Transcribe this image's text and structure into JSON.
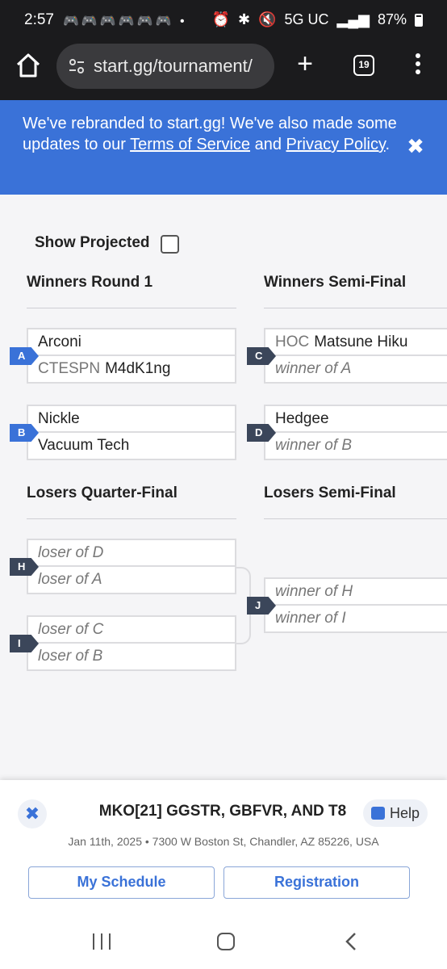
{
  "status_bar": {
    "time": "2:57",
    "notification_icons": "🎮🎮🎮🎮🎮🎮 •",
    "network": "5G UC",
    "battery": "87%"
  },
  "browser": {
    "url": "start.gg/tournament/",
    "tab_count": "19"
  },
  "banner": {
    "text_before": "We've rebranded to start.gg! We've also made some updates to our ",
    "terms_link": "Terms of Service",
    "text_middle": " and ",
    "privacy_link": "Privacy Policy",
    "text_after": "."
  },
  "bracket": {
    "show_projected_label": "Show Projected",
    "rounds": {
      "winners_r1": "Winners Round 1",
      "winners_semi": "Winners Semi-Final",
      "losers_quarter": "Losers Quarter-Final",
      "losers_semi": "Losers Semi-Final"
    },
    "matches": {
      "A": {
        "id": "A",
        "p1": "Arconi",
        "p2_prefix": "CTESPN",
        "p2": "M4dK1ng"
      },
      "B": {
        "id": "B",
        "p1": "Nickle",
        "p2": "Vacuum Tech"
      },
      "C": {
        "id": "C",
        "p1_prefix": "HOC",
        "p1": "Matsune Hiku",
        "p2": "winner of A"
      },
      "D": {
        "id": "D",
        "p1": "Hedgee",
        "p2": "winner of B"
      },
      "H": {
        "id": "H",
        "p1": "loser of D",
        "p2": "loser of A"
      },
      "I": {
        "id": "I",
        "p1": "loser of C",
        "p2": "loser of B"
      },
      "J": {
        "id": "J",
        "p1": "winner of H",
        "p2": "winner of I"
      }
    }
  },
  "sheet": {
    "close_icon": "✖",
    "title": "MKO[21] GGSTR, GBFVR, AND T8",
    "help_label": "Help",
    "details": "Jan 11th, 2025 • 7300 W Boston St, Chandler, AZ 85226, USA",
    "my_schedule": "My Schedule",
    "registration": "Registration"
  },
  "colors": {
    "accent": "#3a72d8",
    "tag_dark": "#3b465a",
    "chrome": "#1b1b1d"
  }
}
